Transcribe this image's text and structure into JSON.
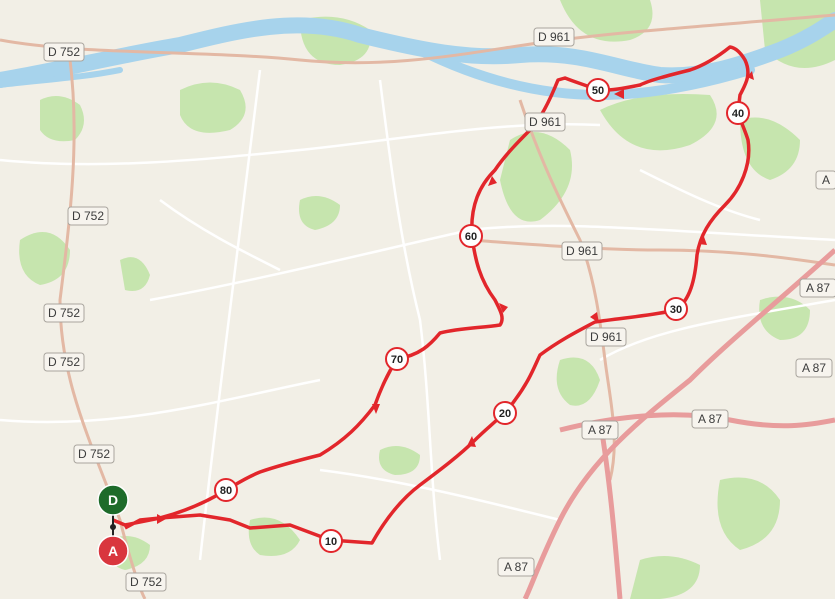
{
  "road_labels": [
    {
      "id": "d752-a",
      "text": "D 752"
    },
    {
      "id": "d961-a",
      "text": "D 961"
    },
    {
      "id": "d961-b",
      "text": "D 961"
    },
    {
      "id": "d752-b",
      "text": "D 752"
    },
    {
      "id": "d961-c",
      "text": "D 961"
    },
    {
      "id": "d752-c",
      "text": "D 752"
    },
    {
      "id": "d752-d",
      "text": "D 752"
    },
    {
      "id": "d961-d",
      "text": "D 961"
    },
    {
      "id": "d752-e",
      "text": "D 752"
    },
    {
      "id": "d752-f",
      "text": "D 752"
    },
    {
      "id": "a87-a",
      "text": "A 87"
    },
    {
      "id": "a87-b",
      "text": "A 87"
    },
    {
      "id": "a87-c",
      "text": "A 87"
    },
    {
      "id": "a87-d",
      "text": "A 87"
    },
    {
      "id": "a87-e",
      "text": "A 87"
    },
    {
      "id": "a-edge",
      "text": "A"
    }
  ],
  "km_markers": [
    "10",
    "20",
    "30",
    "40",
    "50",
    "60",
    "70",
    "80"
  ],
  "start_marker": {
    "label": "D",
    "color": "#1e6b2a"
  },
  "end_marker": {
    "label": "A",
    "color": "#d9363e"
  },
  "colors": {
    "route": "#e2262b",
    "river": "#a7d3ec",
    "forest": "#bfe3a6",
    "motorway": "#e79a9a",
    "road": "#d8a892"
  }
}
